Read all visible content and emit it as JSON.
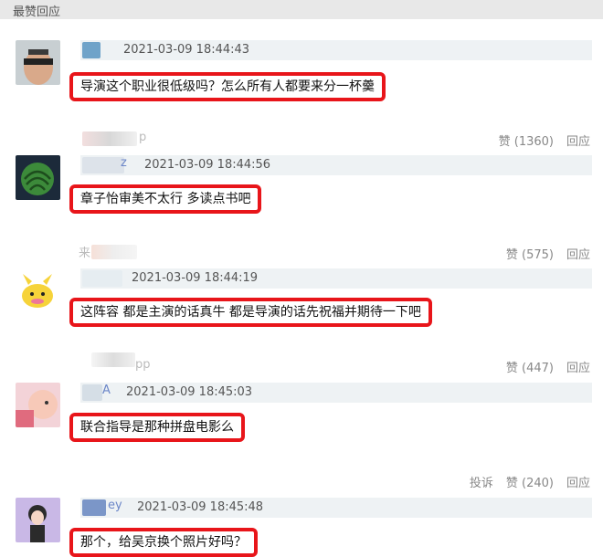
{
  "header": {
    "title": "最赞回应"
  },
  "comments": [
    {
      "time": "2021-03-09 18:44:43",
      "text": "导演这个职业很低级吗？怎么所有人都要来分一杯羹"
    },
    {
      "time": "2021-03-09 18:44:56",
      "text": "章子怡审美不太行 多读点书吧"
    },
    {
      "time": "2021-03-09 18:44:19",
      "text": "这阵容 都是主演的话真牛 都是导演的话先祝福并期待一下吧"
    },
    {
      "time": "2021-03-09 18:45:03",
      "text": "联合指导是那种拼盘电影么"
    },
    {
      "time": "2021-03-09 18:45:48",
      "text": "那个，给吴京换个照片好吗？"
    }
  ],
  "action_rows": [
    {
      "like": "赞 (1360)",
      "reply": "回应",
      "partial": "p"
    },
    {
      "like": "赞 (575)",
      "reply": "回应",
      "partial": "来"
    },
    {
      "like": "赞 (447)",
      "reply": "回应",
      "partial": "pp"
    },
    {
      "report": "投诉",
      "like": "赞 (240)",
      "reply": "回应"
    }
  ],
  "partial_names": [
    "z",
    "A",
    "ey"
  ],
  "colors": {
    "highlight": "#e8151a",
    "meta_bg": "#eef2f4",
    "topbar_bg": "#e8e8e8"
  }
}
